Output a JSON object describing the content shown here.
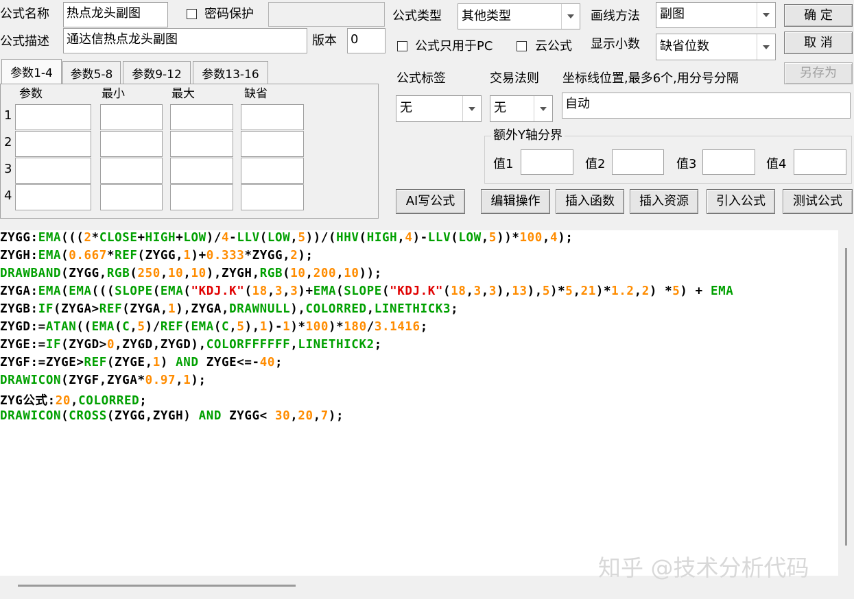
{
  "header": {
    "name_label": "公式名称",
    "name_value": "热点龙头副图",
    "password_label": "密码保护",
    "desc_label": "公式描述",
    "desc_value": "通达信热点龙头副图",
    "version_label": "版本",
    "version_value": "0",
    "type_label": "公式类型",
    "type_value": "其他类型",
    "draw_label": "画线方法",
    "draw_value": "副图",
    "pc_only_label": "公式只用于PC",
    "cloud_label": "云公式",
    "decimals_label": "显示小数",
    "decimals_value": "缺省位数"
  },
  "buttons": {
    "ok": "确  定",
    "cancel": "取  消",
    "save_as": "另存为",
    "ai": "AI写公式",
    "edit": "编辑操作",
    "insert_func": "插入函数",
    "insert_res": "插入资源",
    "import": "引入公式",
    "test": "测试公式"
  },
  "tabs": [
    "参数1-4",
    "参数5-8",
    "参数9-12",
    "参数13-16"
  ],
  "params": {
    "headers": [
      "参数",
      "最小",
      "最大",
      "缺省"
    ],
    "rows": [
      "1",
      "2",
      "3",
      "4"
    ]
  },
  "right": {
    "tag_label": "公式标签",
    "tag_value": "无",
    "rule_label": "交易法则",
    "rule_value": "无",
    "axis_label": "坐标线位置,最多6个,用分号分隔",
    "axis_value": "自动",
    "extra_y_label": "额外Y轴分界",
    "v1": "值1",
    "v2": "值2",
    "v3": "值3",
    "v4": "值4"
  },
  "code_lines": [
    [
      [
        "ZYGG:",
        "k"
      ],
      [
        "EMA",
        "g"
      ],
      [
        "(((",
        "k"
      ],
      [
        "2",
        "o"
      ],
      [
        "*",
        "k"
      ],
      [
        "CLOSE",
        "g"
      ],
      [
        "+",
        "k"
      ],
      [
        "HIGH",
        "g"
      ],
      [
        "+",
        "k"
      ],
      [
        "LOW",
        "g"
      ],
      [
        ")/",
        "k"
      ],
      [
        "4",
        "o"
      ],
      [
        "-",
        "k"
      ],
      [
        "LLV",
        "g"
      ],
      [
        "(",
        "k"
      ],
      [
        "LOW",
        "g"
      ],
      [
        ",",
        "k"
      ],
      [
        "5",
        "o"
      ],
      [
        "))/(",
        "k"
      ],
      [
        "HHV",
        "g"
      ],
      [
        "(",
        "k"
      ],
      [
        "HIGH",
        "g"
      ],
      [
        ",",
        "k"
      ],
      [
        "4",
        "o"
      ],
      [
        ")-",
        "k"
      ],
      [
        "LLV",
        "g"
      ],
      [
        "(",
        "k"
      ],
      [
        "LOW",
        "g"
      ],
      [
        ",",
        "k"
      ],
      [
        "5",
        "o"
      ],
      [
        "))*",
        "k"
      ],
      [
        "100",
        "o"
      ],
      [
        ",",
        "k"
      ],
      [
        "4",
        "o"
      ],
      [
        ");",
        "k"
      ]
    ],
    [
      [
        "ZYGH:",
        "k"
      ],
      [
        "EMA",
        "g"
      ],
      [
        "(",
        "k"
      ],
      [
        "0.667",
        "o"
      ],
      [
        "*",
        "k"
      ],
      [
        "REF",
        "g"
      ],
      [
        "(ZYGG,",
        "k"
      ],
      [
        "1",
        "o"
      ],
      [
        ")+",
        "k"
      ],
      [
        "0.333",
        "o"
      ],
      [
        "*ZYGG,",
        "k"
      ],
      [
        "2",
        "o"
      ],
      [
        ");",
        "k"
      ]
    ],
    [
      [
        "DRAWBAND",
        "g"
      ],
      [
        "(ZYGG,",
        "k"
      ],
      [
        "RGB",
        "g"
      ],
      [
        "(",
        "k"
      ],
      [
        "250",
        "o"
      ],
      [
        ",",
        "k"
      ],
      [
        "10",
        "o"
      ],
      [
        ",",
        "k"
      ],
      [
        "10",
        "o"
      ],
      [
        "),ZYGH,",
        "k"
      ],
      [
        "RGB",
        "g"
      ],
      [
        "(",
        "k"
      ],
      [
        "10",
        "o"
      ],
      [
        ",",
        "k"
      ],
      [
        "200",
        "o"
      ],
      [
        ",",
        "k"
      ],
      [
        "10",
        "o"
      ],
      [
        "));",
        "k"
      ]
    ],
    [
      [
        "ZYGA:",
        "k"
      ],
      [
        "EMA",
        "g"
      ],
      [
        "(",
        "k"
      ],
      [
        "EMA",
        "g"
      ],
      [
        "(((",
        "k"
      ],
      [
        "SLOPE",
        "g"
      ],
      [
        "(",
        "k"
      ],
      [
        "EMA",
        "g"
      ],
      [
        "(",
        "k"
      ],
      [
        "\"KDJ.K\"",
        "r"
      ],
      [
        "(",
        "k"
      ],
      [
        "18",
        "o"
      ],
      [
        ",",
        "k"
      ],
      [
        "3",
        "o"
      ],
      [
        ",",
        "k"
      ],
      [
        "3",
        "o"
      ],
      [
        ")+",
        "k"
      ],
      [
        "EMA",
        "g"
      ],
      [
        "(",
        "k"
      ],
      [
        "SLOPE",
        "g"
      ],
      [
        "(",
        "k"
      ],
      [
        "\"KDJ.K\"",
        "r"
      ],
      [
        "(",
        "k"
      ],
      [
        "18",
        "o"
      ],
      [
        ",",
        "k"
      ],
      [
        "3",
        "o"
      ],
      [
        ",",
        "k"
      ],
      [
        "3",
        "o"
      ],
      [
        "),",
        "k"
      ],
      [
        "13",
        "o"
      ],
      [
        "),",
        "k"
      ],
      [
        "5",
        "o"
      ],
      [
        ")*",
        "k"
      ],
      [
        "5",
        "o"
      ],
      [
        ",",
        "k"
      ],
      [
        "21",
        "o"
      ],
      [
        ")*",
        "k"
      ],
      [
        "1.2",
        "o"
      ],
      [
        ",",
        "k"
      ],
      [
        "2",
        "o"
      ],
      [
        ") *",
        "k"
      ],
      [
        "5",
        "o"
      ],
      [
        ") + ",
        "k"
      ],
      [
        "EMA",
        "g"
      ]
    ],
    [
      [
        "ZYGB:",
        "k"
      ],
      [
        "IF",
        "g"
      ],
      [
        "(ZYGA>",
        "k"
      ],
      [
        "REF",
        "g"
      ],
      [
        "(ZYGA,",
        "k"
      ],
      [
        "1",
        "o"
      ],
      [
        "),ZYGA,",
        "k"
      ],
      [
        "DRAWNULL",
        "g"
      ],
      [
        "),",
        "k"
      ],
      [
        "COLORRED",
        "g"
      ],
      [
        ",",
        "k"
      ],
      [
        "LINETHICK3",
        "g"
      ],
      [
        ";",
        "k"
      ]
    ],
    [
      [
        "ZYGD:=",
        "k"
      ],
      [
        "ATAN",
        "g"
      ],
      [
        "((",
        "k"
      ],
      [
        "EMA",
        "g"
      ],
      [
        "(",
        "k"
      ],
      [
        "C",
        "g"
      ],
      [
        ",",
        "k"
      ],
      [
        "5",
        "o"
      ],
      [
        ")/",
        "k"
      ],
      [
        "REF",
        "g"
      ],
      [
        "(",
        "k"
      ],
      [
        "EMA",
        "g"
      ],
      [
        "(",
        "k"
      ],
      [
        "C",
        "g"
      ],
      [
        ",",
        "k"
      ],
      [
        "5",
        "o"
      ],
      [
        "),",
        "k"
      ],
      [
        "1",
        "o"
      ],
      [
        ")-",
        "k"
      ],
      [
        "1",
        "o"
      ],
      [
        ")*",
        "k"
      ],
      [
        "100",
        "o"
      ],
      [
        ")*",
        "k"
      ],
      [
        "180",
        "o"
      ],
      [
        "/",
        "k"
      ],
      [
        "3.1416",
        "o"
      ],
      [
        ";",
        "k"
      ]
    ],
    [
      [
        "ZYGE:=",
        "k"
      ],
      [
        "IF",
        "g"
      ],
      [
        "(ZYGD>",
        "k"
      ],
      [
        "0",
        "o"
      ],
      [
        ",ZYGD,ZYGD),",
        "k"
      ],
      [
        "COLORFFFFFF",
        "g"
      ],
      [
        ",",
        "k"
      ],
      [
        "LINETHICK2",
        "g"
      ],
      [
        ";",
        "k"
      ]
    ],
    [
      [
        "ZYGF:=ZYGE>",
        "k"
      ],
      [
        "REF",
        "g"
      ],
      [
        "(ZYGE,",
        "k"
      ],
      [
        "1",
        "o"
      ],
      [
        ") ",
        "k"
      ],
      [
        "AND",
        "g"
      ],
      [
        " ZYGE<=-",
        "k"
      ],
      [
        "40",
        "o"
      ],
      [
        ";",
        "k"
      ]
    ],
    [
      [
        "DRAWICON",
        "g"
      ],
      [
        "(ZYGF,ZYGA*",
        "k"
      ],
      [
        "0.97",
        "o"
      ],
      [
        ",",
        "k"
      ],
      [
        "1",
        "o"
      ],
      [
        ");",
        "k"
      ]
    ],
    [
      [
        "ZYG公式:",
        "k"
      ],
      [
        "20",
        "o"
      ],
      [
        ",",
        "k"
      ],
      [
        "COLORRED",
        "g"
      ],
      [
        ";",
        "k"
      ]
    ],
    [
      [
        "DRAWICON",
        "g"
      ],
      [
        "(",
        "k"
      ],
      [
        "CROSS",
        "g"
      ],
      [
        "(ZYGG,ZYGH) ",
        "k"
      ],
      [
        "AND",
        "g"
      ],
      [
        " ZYGG< ",
        "k"
      ],
      [
        "30",
        "o"
      ],
      [
        ",",
        "k"
      ],
      [
        "20",
        "o"
      ],
      [
        ",",
        "k"
      ],
      [
        "7",
        "o"
      ],
      [
        ");",
        "k"
      ]
    ]
  ],
  "code_colors": {
    "k": "#000000",
    "g": "#00a000",
    "o": "#ff8c00",
    "r": "#e00000"
  },
  "watermark": "知乎 @技术分析代码"
}
